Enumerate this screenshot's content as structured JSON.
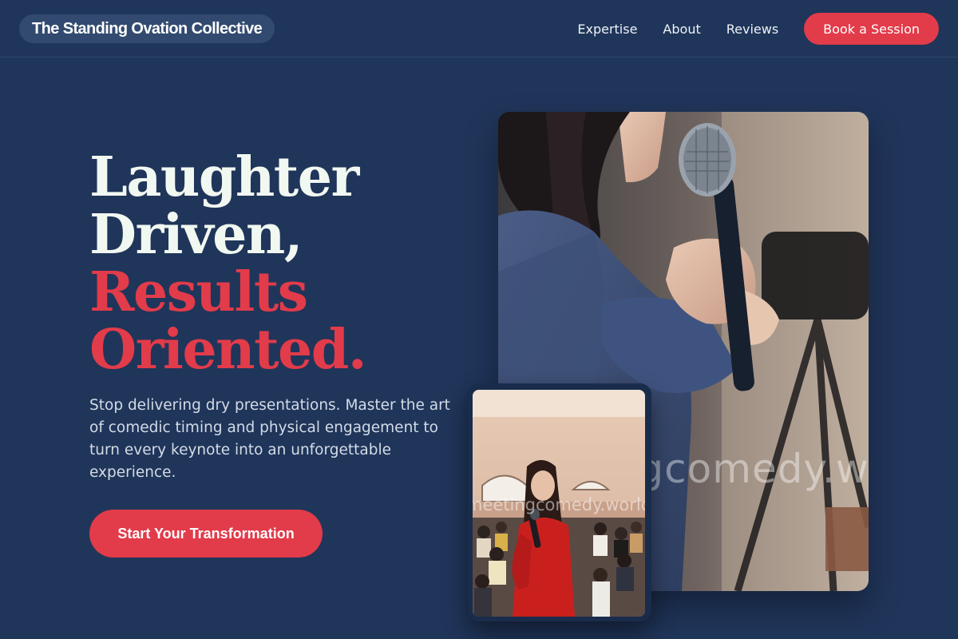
{
  "header": {
    "brand": "The Standing Ovation Collective",
    "nav": [
      "Expertise",
      "About",
      "Reviews"
    ],
    "book_label": "Book a Session"
  },
  "hero": {
    "headline": [
      "Laughter",
      "Driven,",
      "Results",
      "Oriented."
    ],
    "lede": "Stop delivering dry presentations. Master the art of comedic timing and physical engagement to turn every keynote into an unforgettable experience.",
    "cta_label": "Start Your Transformation"
  },
  "images": {
    "main_watermark": "meetingcomedy.world",
    "secondary_watermark": "meetingcomedy.world"
  },
  "colors": {
    "background": "#20355a",
    "accent": "#e23b4a",
    "headline_light": "#f1f8f1",
    "brand_pill": "#324a70"
  }
}
